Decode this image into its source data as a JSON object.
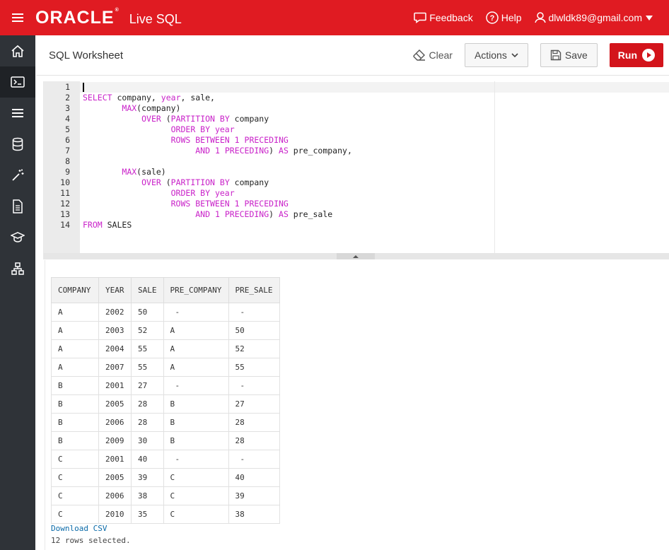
{
  "topbar": {
    "logo": "ORACLE",
    "logo_mark": "®",
    "product": "Live SQL",
    "feedback": "Feedback",
    "help": "Help",
    "user": "dlwldk89@gmail.com"
  },
  "sidenav": [
    "home-icon",
    "worksheet-icon",
    "list-icon",
    "database-icon",
    "wand-icon",
    "document-icon",
    "graduation-cap-icon",
    "schema-icon"
  ],
  "header": {
    "title": "SQL Worksheet",
    "clear": "Clear",
    "actions": "Actions",
    "save": "Save",
    "run": "Run"
  },
  "editor": {
    "line_numbers": [
      "1",
      "2",
      "3",
      "4",
      "5",
      "6",
      "7",
      "8",
      "9",
      "10",
      "11",
      "12",
      "13",
      "14"
    ]
  },
  "results": {
    "columns": [
      "COMPANY",
      "YEAR",
      "SALE",
      "PRE_COMPANY",
      "PRE_SALE"
    ],
    "rows": [
      [
        "A",
        "2002",
        "50",
        "-",
        "-"
      ],
      [
        "A",
        "2003",
        "52",
        "A",
        "50"
      ],
      [
        "A",
        "2004",
        "55",
        "A",
        "52"
      ],
      [
        "A",
        "2007",
        "55",
        "A",
        "55"
      ],
      [
        "B",
        "2001",
        "27",
        "-",
        "-"
      ],
      [
        "B",
        "2005",
        "28",
        "B",
        "27"
      ],
      [
        "B",
        "2006",
        "28",
        "B",
        "28"
      ],
      [
        "B",
        "2009",
        "30",
        "B",
        "28"
      ],
      [
        "C",
        "2001",
        "40",
        "-",
        "-"
      ],
      [
        "C",
        "2005",
        "39",
        "C",
        "40"
      ],
      [
        "C",
        "2006",
        "38",
        "C",
        "39"
      ],
      [
        "C",
        "2010",
        "35",
        "C",
        "38"
      ]
    ],
    "download": "Download CSV",
    "rowcount": "12 rows selected."
  }
}
